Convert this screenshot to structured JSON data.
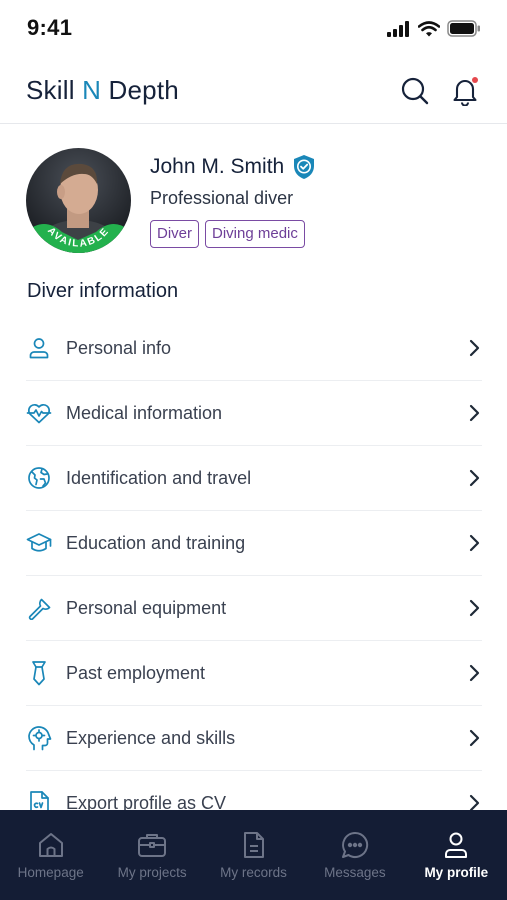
{
  "status_bar": {
    "time": "9:41"
  },
  "header": {
    "brand_part1": "Skill ",
    "brand_accent": "N",
    "brand_part2": " Depth"
  },
  "profile": {
    "name": "John M. Smith",
    "title": "Professional diver",
    "availability": "AVAILABLE",
    "tags": [
      "Diver",
      "Diving medic"
    ]
  },
  "section_title": "Diver information",
  "items": [
    {
      "label": "Personal info",
      "icon": "user-icon"
    },
    {
      "label": "Medical information",
      "icon": "heart-pulse-icon"
    },
    {
      "label": "Identification and travel",
      "icon": "globe-icon"
    },
    {
      "label": "Education and training",
      "icon": "graduation-cap-icon"
    },
    {
      "label": "Personal equipment",
      "icon": "wrench-icon"
    },
    {
      "label": "Past employment",
      "icon": "necktie-icon"
    },
    {
      "label": "Experience and skills",
      "icon": "head-gear-icon"
    },
    {
      "label": "Export profile as CV",
      "icon": "cv-document-icon"
    }
  ],
  "nav": [
    {
      "label": "Homepage",
      "icon": "home-icon",
      "active": false
    },
    {
      "label": "My projects",
      "icon": "briefcase-icon",
      "active": false
    },
    {
      "label": "My records",
      "icon": "document-icon",
      "active": false
    },
    {
      "label": "Messages",
      "icon": "chat-icon",
      "active": false
    },
    {
      "label": "My profile",
      "icon": "profile-icon",
      "active": true
    }
  ],
  "colors": {
    "accent": "#1a87b8",
    "tag": "#7a4ba3",
    "available": "#23b14d",
    "nav_bg": "#141d35"
  }
}
